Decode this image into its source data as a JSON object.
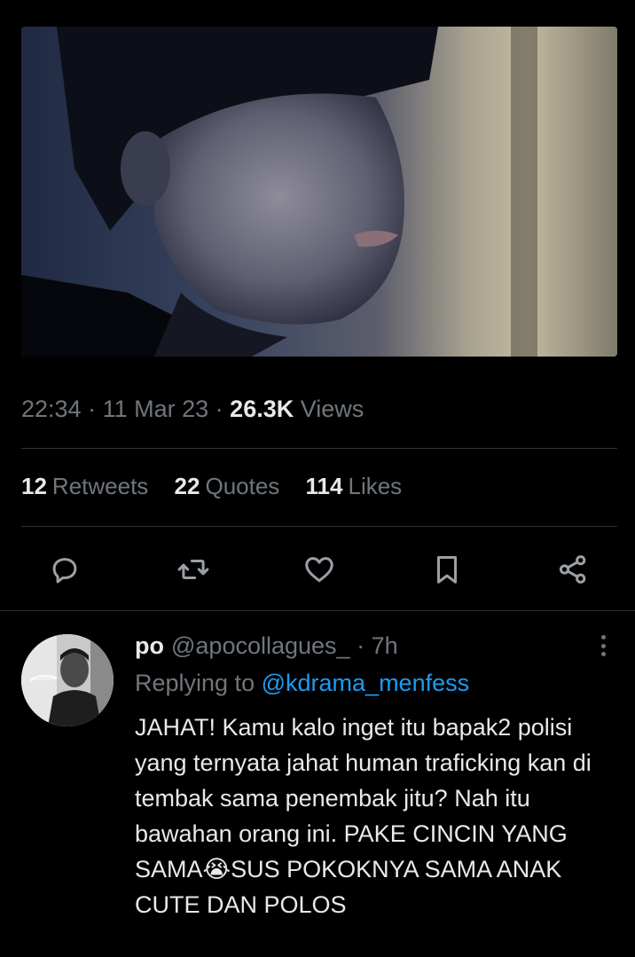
{
  "tweet": {
    "time": "22:34",
    "date": "11 Mar 23",
    "views_count": "26.3K",
    "views_label": "Views",
    "stats": [
      {
        "count": "12",
        "label": "Retweets"
      },
      {
        "count": "22",
        "label": "Quotes"
      },
      {
        "count": "114",
        "label": "Likes"
      }
    ]
  },
  "icons": {
    "reply": "reply-icon",
    "retweet": "retweet-icon",
    "like": "heart-icon",
    "bookmark": "bookmark-icon",
    "share": "share-icon"
  },
  "reply": {
    "display_name": "po",
    "handle": "@apocollagues_",
    "separator": "·",
    "age": "7h",
    "replying_prefix": "Replying to",
    "replying_to": "@kdrama_menfess",
    "text_before_emoji": "JAHAT! Kamu kalo inget itu bapak2 polisi yang ternyata jahat human traficking kan di tembak sama penembak jitu? Nah itu bawahan orang ini. PAKE CINCIN YANG SAMA",
    "emoji": "😭",
    "text_after_emoji": "SUS POKOKNYA SAMA ANAK CUTE DAN POLOS"
  },
  "colors": {
    "background": "#000000",
    "text": "#e7e9ea",
    "secondary": "#71767b",
    "accent": "#1d9bf0",
    "divider": "#2f3336"
  }
}
